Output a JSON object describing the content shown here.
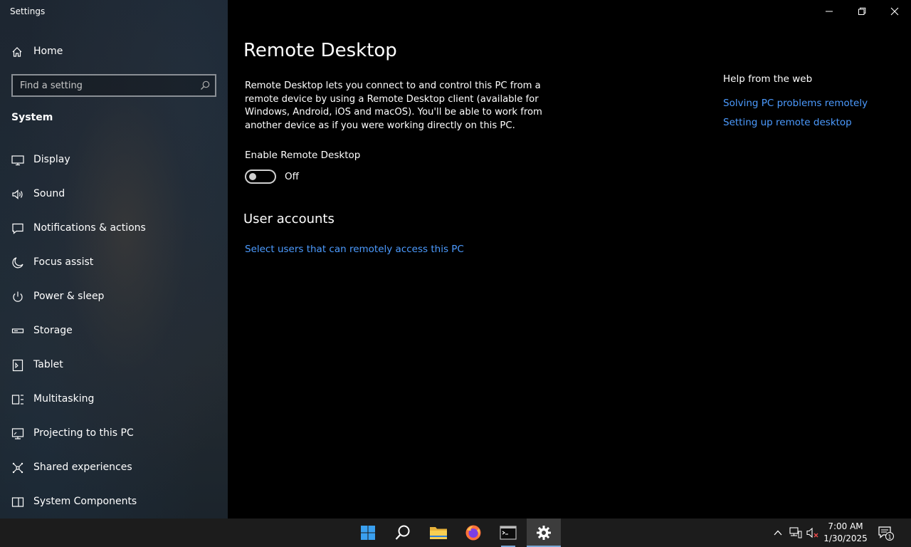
{
  "window": {
    "title": "Settings"
  },
  "sidebar": {
    "home_label": "Home",
    "search_placeholder": "Find a setting",
    "section_title": "System",
    "items": [
      {
        "label": "Display",
        "icon": "display-icon"
      },
      {
        "label": "Sound",
        "icon": "sound-icon"
      },
      {
        "label": "Notifications & actions",
        "icon": "notifications-icon"
      },
      {
        "label": "Focus assist",
        "icon": "moon-icon"
      },
      {
        "label": "Power & sleep",
        "icon": "power-icon"
      },
      {
        "label": "Storage",
        "icon": "storage-icon"
      },
      {
        "label": "Tablet",
        "icon": "tablet-icon"
      },
      {
        "label": "Multitasking",
        "icon": "multitasking-icon"
      },
      {
        "label": "Projecting to this PC",
        "icon": "projecting-icon"
      },
      {
        "label": "Shared experiences",
        "icon": "shared-experiences-icon"
      },
      {
        "label": "System Components",
        "icon": "system-components-icon"
      }
    ]
  },
  "main": {
    "title": "Remote Desktop",
    "description": "Remote Desktop lets you connect to and control this PC from a remote device by using a Remote Desktop client (available for Windows, Android, iOS and macOS). You'll be able to work from another device as if you were working directly on this PC.",
    "enable_label": "Enable Remote Desktop",
    "toggle_state": "Off",
    "user_accounts_title": "User accounts",
    "user_accounts_link": "Select users that can remotely access this PC"
  },
  "help": {
    "title": "Help from the web",
    "links": [
      "Solving PC problems remotely",
      "Setting up remote desktop"
    ]
  },
  "taskbar": {
    "apps": [
      "start-icon",
      "search-icon",
      "file-explorer-icon",
      "firefox-icon",
      "terminal-icon",
      "settings-icon"
    ],
    "active_app": "settings-icon",
    "clock": {
      "time": "7:00 AM",
      "date": "1/30/2025"
    },
    "notification_count": "1"
  },
  "colors": {
    "accent_link": "#4c9bff",
    "taskbar": "#1c1c1c",
    "background": "#000000"
  }
}
